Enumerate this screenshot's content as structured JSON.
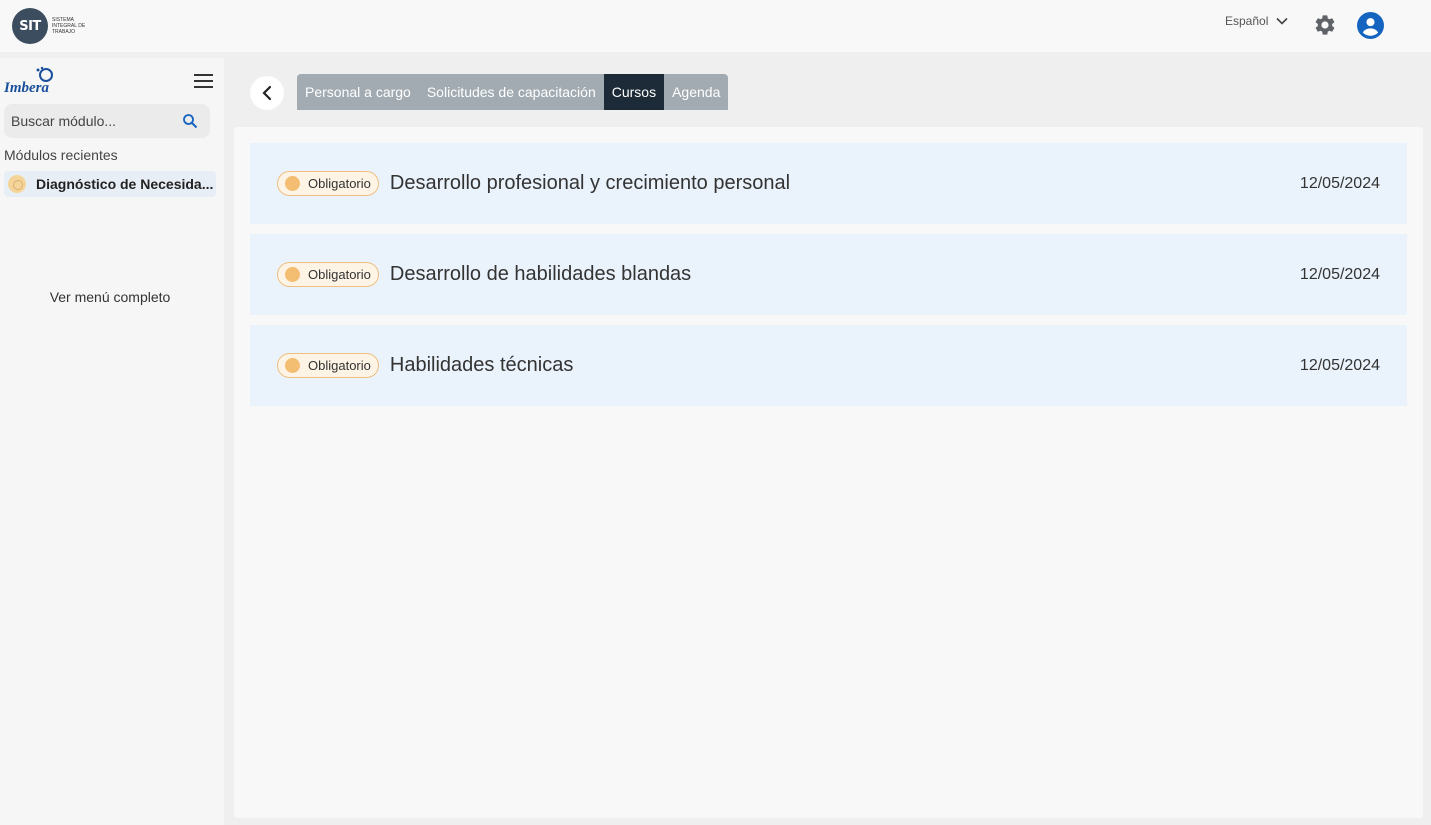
{
  "header": {
    "logo_mark": "SIT",
    "logo_text": "Sistema Integral de Trabajo",
    "language": "Español"
  },
  "sidebar": {
    "brand": "Imbera",
    "search_placeholder": "Buscar módulo...",
    "recent_title": "Módulos recientes",
    "recent_items": [
      {
        "label": "Diagnóstico de Necesida..."
      }
    ],
    "full_menu_label": "Ver menú completo"
  },
  "tabs": [
    {
      "label": "Personal a cargo",
      "active": false
    },
    {
      "label": "Solicitudes de capacitación",
      "active": false
    },
    {
      "label": "Cursos",
      "active": true
    },
    {
      "label": "Agenda",
      "active": false
    }
  ],
  "courses": [
    {
      "badge": "Obligatorio",
      "title": "Desarrollo profesional y crecimiento personal",
      "date": "12/05/2024"
    },
    {
      "badge": "Obligatorio",
      "title": "Desarrollo de habilidades blandas",
      "date": "12/05/2024"
    },
    {
      "badge": "Obligatorio",
      "title": "Habilidades técnicas",
      "date": "12/05/2024"
    }
  ],
  "colors": {
    "active_tab": "#1c2b37",
    "inactive_tab": "#a2abb2",
    "card_bg": "#eaf2fb",
    "badge_dot": "#f3bd72",
    "brand_blue": "#1a4f9c",
    "user_icon": "#1565c0"
  },
  "icons": [
    "settings-gear-icon",
    "user-account-icon",
    "chevron-down-icon",
    "search-icon",
    "menu-icon",
    "back-arrow-icon"
  ]
}
